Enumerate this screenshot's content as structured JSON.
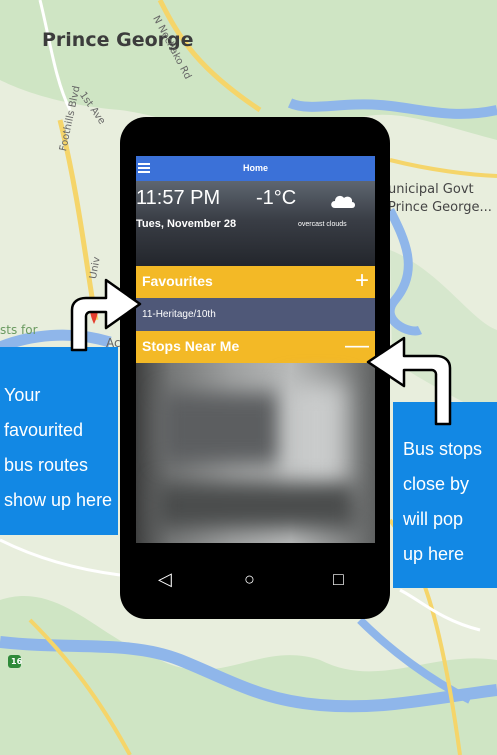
{
  "map": {
    "city_label": "Prince George",
    "municipal_line1": "unicipal Govt",
    "municipal_line2": "Prince George...",
    "street_labels": [
      "N Nechako Rd",
      "1st Ave",
      "Foothills Blvd",
      "Univ",
      "sts for",
      "Ac"
    ],
    "highway_shield": "16"
  },
  "app": {
    "title": "Home",
    "menu_icon": "hamburger-menu-icon",
    "weather": {
      "time": "11:57 PM",
      "temperature": "-1°C",
      "date": "Tues, November 28",
      "condition": "overcast clouds",
      "icon": "cloud-icon"
    },
    "favourites": {
      "label": "Favourites",
      "button": "+",
      "items": [
        {
          "label": "11-Heritage/10th"
        }
      ]
    },
    "stops_near_me": {
      "label": "Stops Near Me",
      "button": "—"
    },
    "nav": {
      "back": "◁",
      "home": "○",
      "recent": "□"
    }
  },
  "callouts": {
    "left": [
      "Your",
      "favourited",
      "bus routes",
      "show up here"
    ],
    "right": [
      "Bus stops",
      "close by",
      "will pop",
      "up here"
    ]
  },
  "colors": {
    "app_bar": "#3b71d8",
    "section_bar": "#f3b926",
    "favourite_item": "#4f5878",
    "callout": "#1288e4",
    "map_river": "#8fb6ea",
    "map_road": "#f5d56a"
  }
}
